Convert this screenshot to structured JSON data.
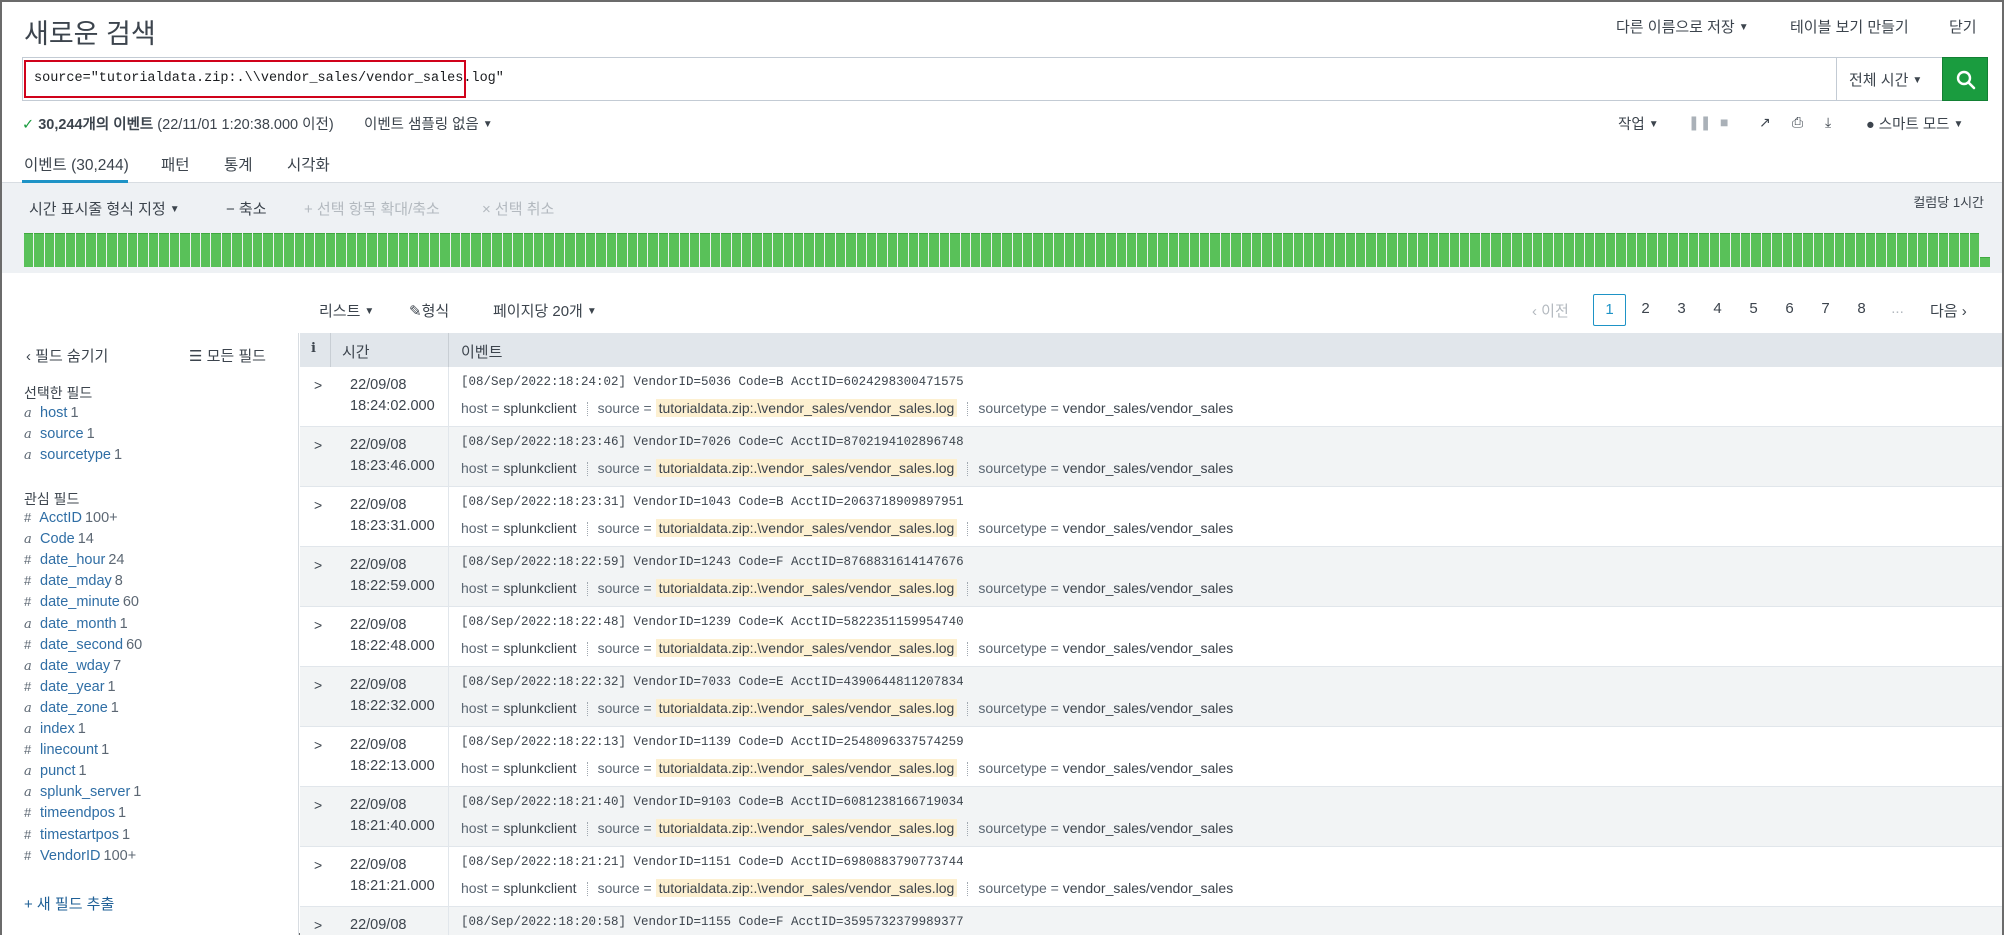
{
  "header": {
    "title": "새로운 검색",
    "save_as": "다른 이름으로 저장",
    "create_table_view": "테이블 보기 만들기",
    "close": "닫기"
  },
  "search": {
    "query": "source=\"tutorialdata.zip:.\\\\vendor_sales/vendor_sales.log\"",
    "time_range": "전체 시간"
  },
  "status": {
    "count_text": "30,244개의 이벤트",
    "time_text": "(22/11/01 1:20:38.000 이전)",
    "sampling": "이벤트 샘플링 없음",
    "job": "작업",
    "mode": "스마트 모드"
  },
  "tabs": [
    {
      "label": "이벤트 (30,244)"
    },
    {
      "label": "패턴"
    },
    {
      "label": "통계"
    },
    {
      "label": "시각화"
    }
  ],
  "timeline": {
    "format": "시간 표시줄 형식 지정",
    "zoom_out": "− 축소",
    "zoom_to_selection": "+ 선택 항목 확대/축소",
    "deselect": "× 선택 취소",
    "per_column": "컬럼당 1시간",
    "bar_levels": [
      1,
      1,
      1,
      1,
      1,
      1,
      1,
      1,
      1,
      1,
      1,
      1,
      1,
      1,
      1,
      1,
      1,
      1,
      1,
      1,
      1,
      1,
      1,
      1,
      1,
      1,
      1,
      1,
      1,
      1,
      1,
      1,
      1,
      1,
      1,
      1,
      1,
      1,
      1,
      1,
      1,
      1,
      1,
      1,
      1,
      1,
      1,
      1,
      1,
      1,
      1,
      1,
      1,
      1,
      1,
      1,
      1,
      1,
      1,
      1,
      1,
      1,
      1,
      1,
      1,
      1,
      1,
      1,
      1,
      1,
      1,
      1,
      1,
      1,
      1,
      1,
      1,
      1,
      1,
      1,
      1,
      1,
      1,
      1,
      1,
      1,
      1,
      1,
      1,
      1,
      1,
      1,
      1,
      1,
      1,
      1,
      1,
      1,
      1,
      1,
      1,
      1,
      1,
      1,
      1,
      1,
      1,
      1,
      1,
      1,
      1,
      1,
      1,
      1,
      1,
      1,
      1,
      1,
      1,
      1,
      1,
      1,
      1,
      1,
      1,
      1,
      1,
      1,
      1,
      1,
      1,
      1,
      1,
      1,
      1,
      1,
      1,
      1,
      1,
      1,
      1,
      1,
      1,
      1,
      1,
      1,
      1,
      1,
      1,
      1,
      1,
      1,
      1,
      1,
      1,
      1,
      1,
      1,
      1,
      1,
      1,
      1,
      1,
      1,
      1,
      1,
      1,
      1,
      1,
      1,
      1,
      1,
      1,
      1,
      1,
      1,
      1,
      1,
      1,
      1,
      1,
      1,
      1,
      1,
      1,
      1,
      1,
      1,
      0.3
    ]
  },
  "results": {
    "list": "리스트",
    "format": "형식",
    "per_page": "페이지당 20개",
    "prev": "‹ 이전",
    "next": "다음 ›",
    "pages": [
      "1",
      "2",
      "3",
      "4",
      "5",
      "6",
      "7",
      "8",
      "..."
    ]
  },
  "sidebar": {
    "hide_fields": "‹ 필드 숨기기",
    "all_fields": "☰ 모든 필드",
    "selected_title": "선택한 필드",
    "selected": [
      {
        "type": "a",
        "name": "host",
        "count": "1"
      },
      {
        "type": "a",
        "name": "source",
        "count": "1"
      },
      {
        "type": "a",
        "name": "sourcetype",
        "count": "1"
      }
    ],
    "interesting_title": "관심 필드",
    "interesting": [
      {
        "type": "#",
        "name": "AcctID",
        "count": "100+"
      },
      {
        "type": "a",
        "name": "Code",
        "count": "14"
      },
      {
        "type": "#",
        "name": "date_hour",
        "count": "24"
      },
      {
        "type": "#",
        "name": "date_mday",
        "count": "8"
      },
      {
        "type": "#",
        "name": "date_minute",
        "count": "60"
      },
      {
        "type": "a",
        "name": "date_month",
        "count": "1"
      },
      {
        "type": "#",
        "name": "date_second",
        "count": "60"
      },
      {
        "type": "a",
        "name": "date_wday",
        "count": "7"
      },
      {
        "type": "#",
        "name": "date_year",
        "count": "1"
      },
      {
        "type": "a",
        "name": "date_zone",
        "count": "1"
      },
      {
        "type": "a",
        "name": "index",
        "count": "1"
      },
      {
        "type": "#",
        "name": "linecount",
        "count": "1"
      },
      {
        "type": "a",
        "name": "punct",
        "count": "1"
      },
      {
        "type": "a",
        "name": "splunk_server",
        "count": "1"
      },
      {
        "type": "#",
        "name": "timeendpos",
        "count": "1"
      },
      {
        "type": "#",
        "name": "timestartpos",
        "count": "1"
      },
      {
        "type": "#",
        "name": "VendorID",
        "count": "100+"
      }
    ],
    "extract": "+ 새 필드 추출"
  },
  "table": {
    "col_info": "i",
    "col_time": "시간",
    "col_event": "이벤트",
    "meta_host_key": "host =",
    "meta_host_val": "splunkclient",
    "meta_source_key": "source =",
    "meta_source_val": "tutorialdata.zip:.\\vendor_sales/vendor_sales.log",
    "meta_st_key": "sourcetype =",
    "meta_st_val": "vendor_sales/vendor_sales",
    "rows": [
      {
        "date": "22/09/08",
        "time": "18:24:02.000",
        "raw": "[08/Sep/2022:18:24:02] VendorID=5036 Code=B AcctID=6024298300471575"
      },
      {
        "date": "22/09/08",
        "time": "18:23:46.000",
        "raw": "[08/Sep/2022:18:23:46] VendorID=7026 Code=C AcctID=8702194102896748"
      },
      {
        "date": "22/09/08",
        "time": "18:23:31.000",
        "raw": "[08/Sep/2022:18:23:31] VendorID=1043 Code=B AcctID=2063718909897951"
      },
      {
        "date": "22/09/08",
        "time": "18:22:59.000",
        "raw": "[08/Sep/2022:18:22:59] VendorID=1243 Code=F AcctID=8768831614147676"
      },
      {
        "date": "22/09/08",
        "time": "18:22:48.000",
        "raw": "[08/Sep/2022:18:22:48] VendorID=1239 Code=K AcctID=5822351159954740"
      },
      {
        "date": "22/09/08",
        "time": "18:22:32.000",
        "raw": "[08/Sep/2022:18:22:32] VendorID=7033 Code=E AcctID=4390644811207834"
      },
      {
        "date": "22/09/08",
        "time": "18:22:13.000",
        "raw": "[08/Sep/2022:18:22:13] VendorID=1139 Code=D AcctID=2548096337574259"
      },
      {
        "date": "22/09/08",
        "time": "18:21:40.000",
        "raw": "[08/Sep/2022:18:21:40] VendorID=9103 Code=B AcctID=6081238166719034"
      },
      {
        "date": "22/09/08",
        "time": "18:21:21.000",
        "raw": "[08/Sep/2022:18:21:21] VendorID=1151 Code=D AcctID=6980883790773744"
      },
      {
        "date": "22/09/08",
        "time": "",
        "raw": "[08/Sep/2022:18:20:58] VendorID=1155 Code=F AcctID=3595732379989377"
      }
    ]
  },
  "colors": {
    "accent": "#1e93c6",
    "search_button": "#1a9c3f",
    "histogram": "#59c159",
    "highlight_box": "#d0021b",
    "source_highlight": "#fdf0d1"
  }
}
